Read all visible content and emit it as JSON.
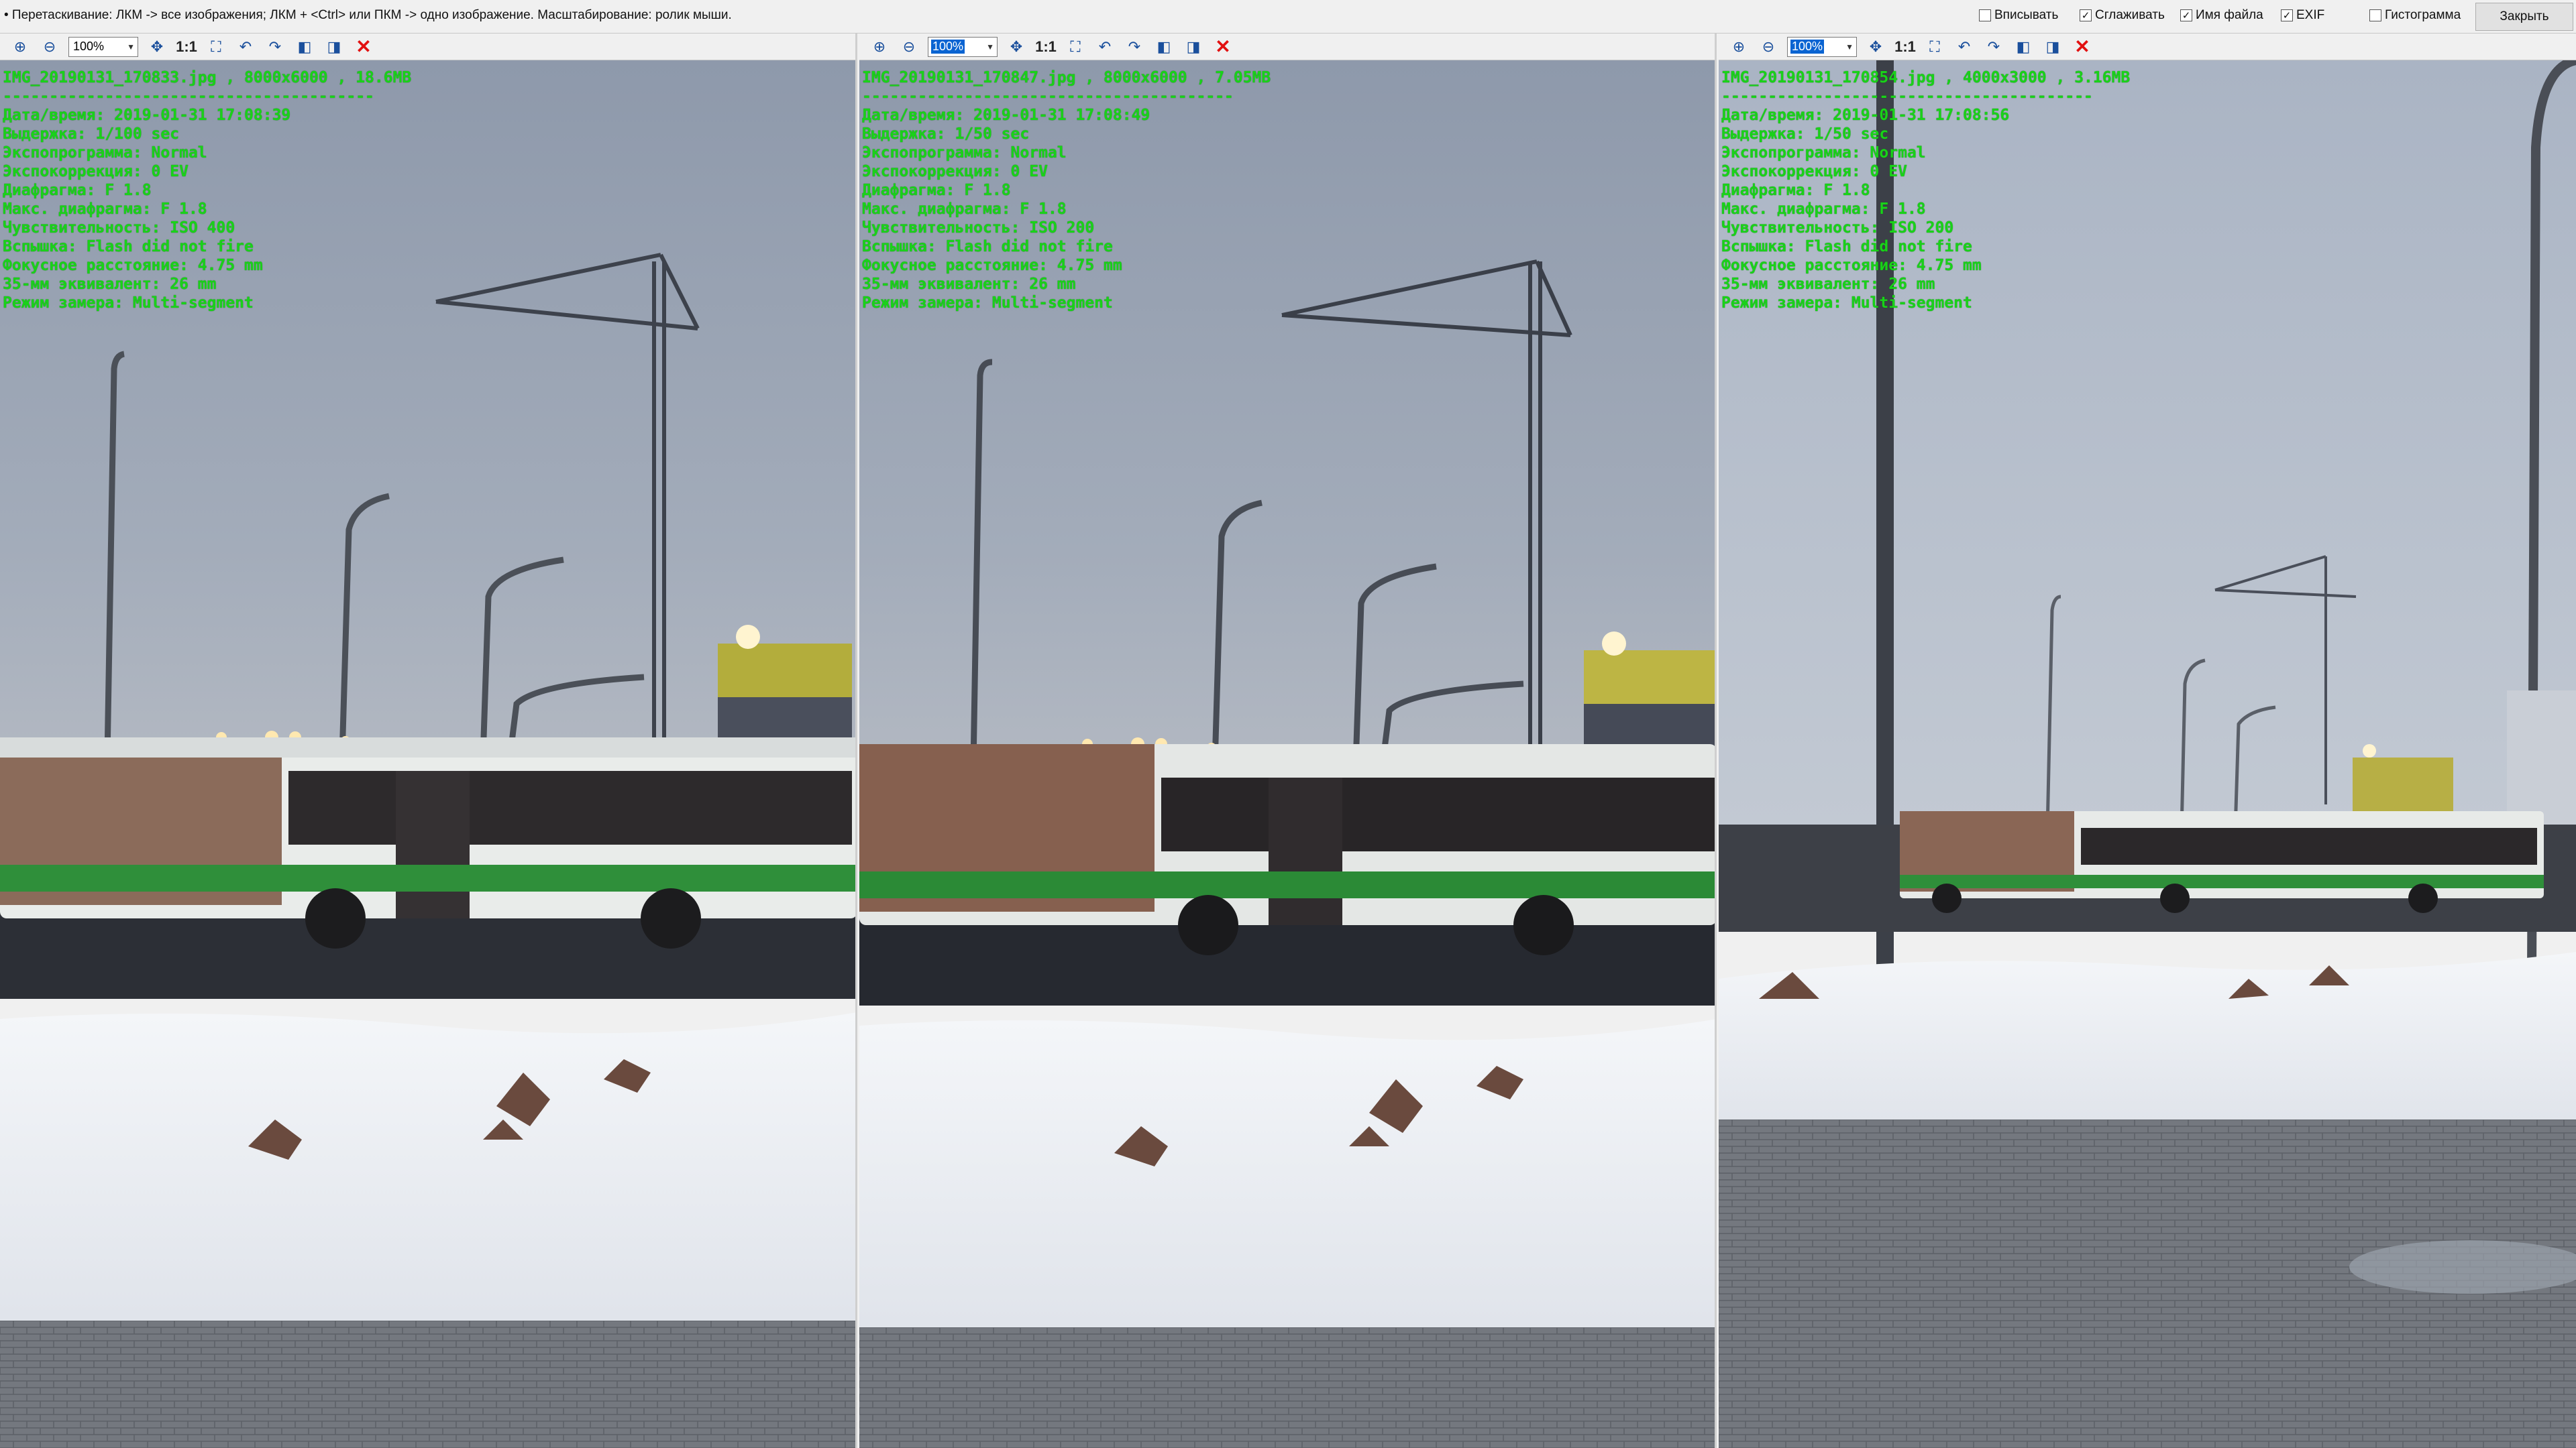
{
  "topbar": {
    "hint": "• Перетаскивание: ЛКМ -> все изображения; ЛКМ + <Ctrl> или ПКМ -> одно изображение. Масштабирование: ролик мыши.",
    "options": [
      {
        "label": "Вписывать",
        "checked": false
      },
      {
        "label": "Сглаживать",
        "checked": true
      },
      {
        "label": "Имя файла",
        "checked": true
      },
      {
        "label": "EXIF",
        "checked": true
      },
      {
        "label": "Гистограмма",
        "checked": false
      }
    ],
    "close_label": "Закрыть"
  },
  "toolbar": {
    "zoom_in_icon": "zoom-in-icon",
    "zoom_out_icon": "zoom-out-icon",
    "one_to_one_label": "1:1",
    "close_glyph": "✕"
  },
  "panes": [
    {
      "zoom": "100%",
      "zoom_selected": false,
      "filename_line": "IMG_20190131_170833.jpg , 8000x6000 , 18.6MB",
      "separator": "----------------------------------------",
      "exif": [
        "Дата/время: 2019-01-31 17:08:39",
        "Выдержка: 1/100 sec",
        "Экспопрограмма: Normal",
        "Экспокоррекция: 0 EV",
        "Диафрагма: F 1.8",
        "Макс. диафрагма: F 1.8",
        "Чувствительность: ISO 400",
        "Вспышка: Flash did not fire",
        "Фокусное расстояние: 4.75 mm",
        "35-мм эквивалент: 26 mm",
        "Режим замера: Multi-segment"
      ]
    },
    {
      "zoom": "100%",
      "zoom_selected": true,
      "filename_line": "IMG_20190131_170847.jpg , 8000x6000 , 7.05MB",
      "separator": "----------------------------------------",
      "exif": [
        "Дата/время: 2019-01-31 17:08:49",
        "Выдержка: 1/50 sec",
        "Экспопрограмма: Normal",
        "Экспокоррекция: 0 EV",
        "Диафрагма: F 1.8",
        "Макс. диафрагма: F 1.8",
        "Чувствительность: ISO 200",
        "Вспышка: Flash did not fire",
        "Фокусное расстояние: 4.75 mm",
        "35-мм эквивалент: 26 mm",
        "Режим замера: Multi-segment"
      ]
    },
    {
      "zoom": "100%",
      "zoom_selected": true,
      "filename_line": "IMG_20190131_170854.jpg , 4000x3000 , 3.16MB",
      "separator": "----------------------------------------",
      "exif": [
        "Дата/время: 2019-01-31 17:08:56",
        "Выдержка: 1/50 sec",
        "Экспопрограмма: Normal",
        "Экспокоррекция: 0 EV",
        "Диафрагма: F 1.8",
        "Макс. диафрагма: F 1.8",
        "Чувствительность: ISO 200",
        "Вспышка: Flash did not fire",
        "Фокусное расстояние: 4.75 mm",
        "35-мм эквивалент: 26 mm",
        "Режим замера: Multi-segment"
      ]
    }
  ],
  "colors": {
    "overlay_text": "#19d219",
    "sky": "#9aa6b6",
    "bus_green": "#2f8f3a",
    "snow": "#eef1f5"
  }
}
